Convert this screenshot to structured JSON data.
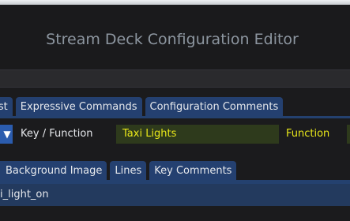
{
  "window": {
    "title": "Stream Deck Configuration Editor"
  },
  "top_tabs": [
    {
      "label": "List"
    },
    {
      "label": "Expressive Commands"
    },
    {
      "label": "Configuration Comments"
    }
  ],
  "key_row": {
    "label": "Key / Function",
    "key_name_value": "Taxi Lights",
    "type_label": "Function"
  },
  "detail_tabs": [
    {
      "label": "Background Image"
    },
    {
      "label": "Lines"
    },
    {
      "label": "Key Comments"
    }
  ],
  "lines_list": [
    {
      "text": "i_light_on"
    }
  ],
  "colors": {
    "tab_bg": "#244070",
    "selected_row": "#233a5e",
    "highlight_text": "#e9e81a",
    "input_bg": "#2e3a1c",
    "title_text": "#8d96a0"
  }
}
